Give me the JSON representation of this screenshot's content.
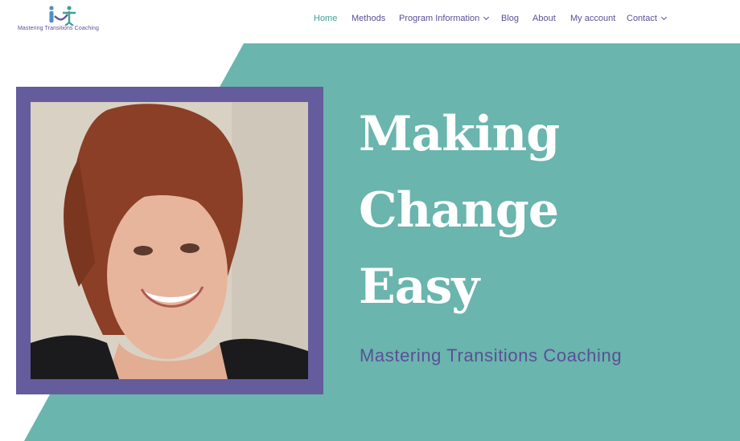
{
  "brand": {
    "logo_text": "Mastering Transitions Coaching"
  },
  "nav": {
    "items": [
      {
        "label": "Home",
        "active": true,
        "dropdown": false
      },
      {
        "label": "Methods",
        "active": false,
        "dropdown": false
      },
      {
        "label": "Program Information",
        "active": false,
        "dropdown": true
      },
      {
        "label": "Blog",
        "active": false,
        "dropdown": false
      },
      {
        "label": "About",
        "active": false,
        "dropdown": false
      },
      {
        "label": "My account",
        "active": false,
        "dropdown": false
      },
      {
        "label": "Contact",
        "active": false,
        "dropdown": true
      }
    ]
  },
  "hero": {
    "headline": [
      "Making",
      "Change",
      "Easy"
    ],
    "subtitle": "Mastering Transitions Coaching"
  },
  "colors": {
    "teal": "#6ab5ad",
    "purple": "#645c9c",
    "nav_text": "#5b4f96",
    "nav_active": "#3ea294"
  }
}
